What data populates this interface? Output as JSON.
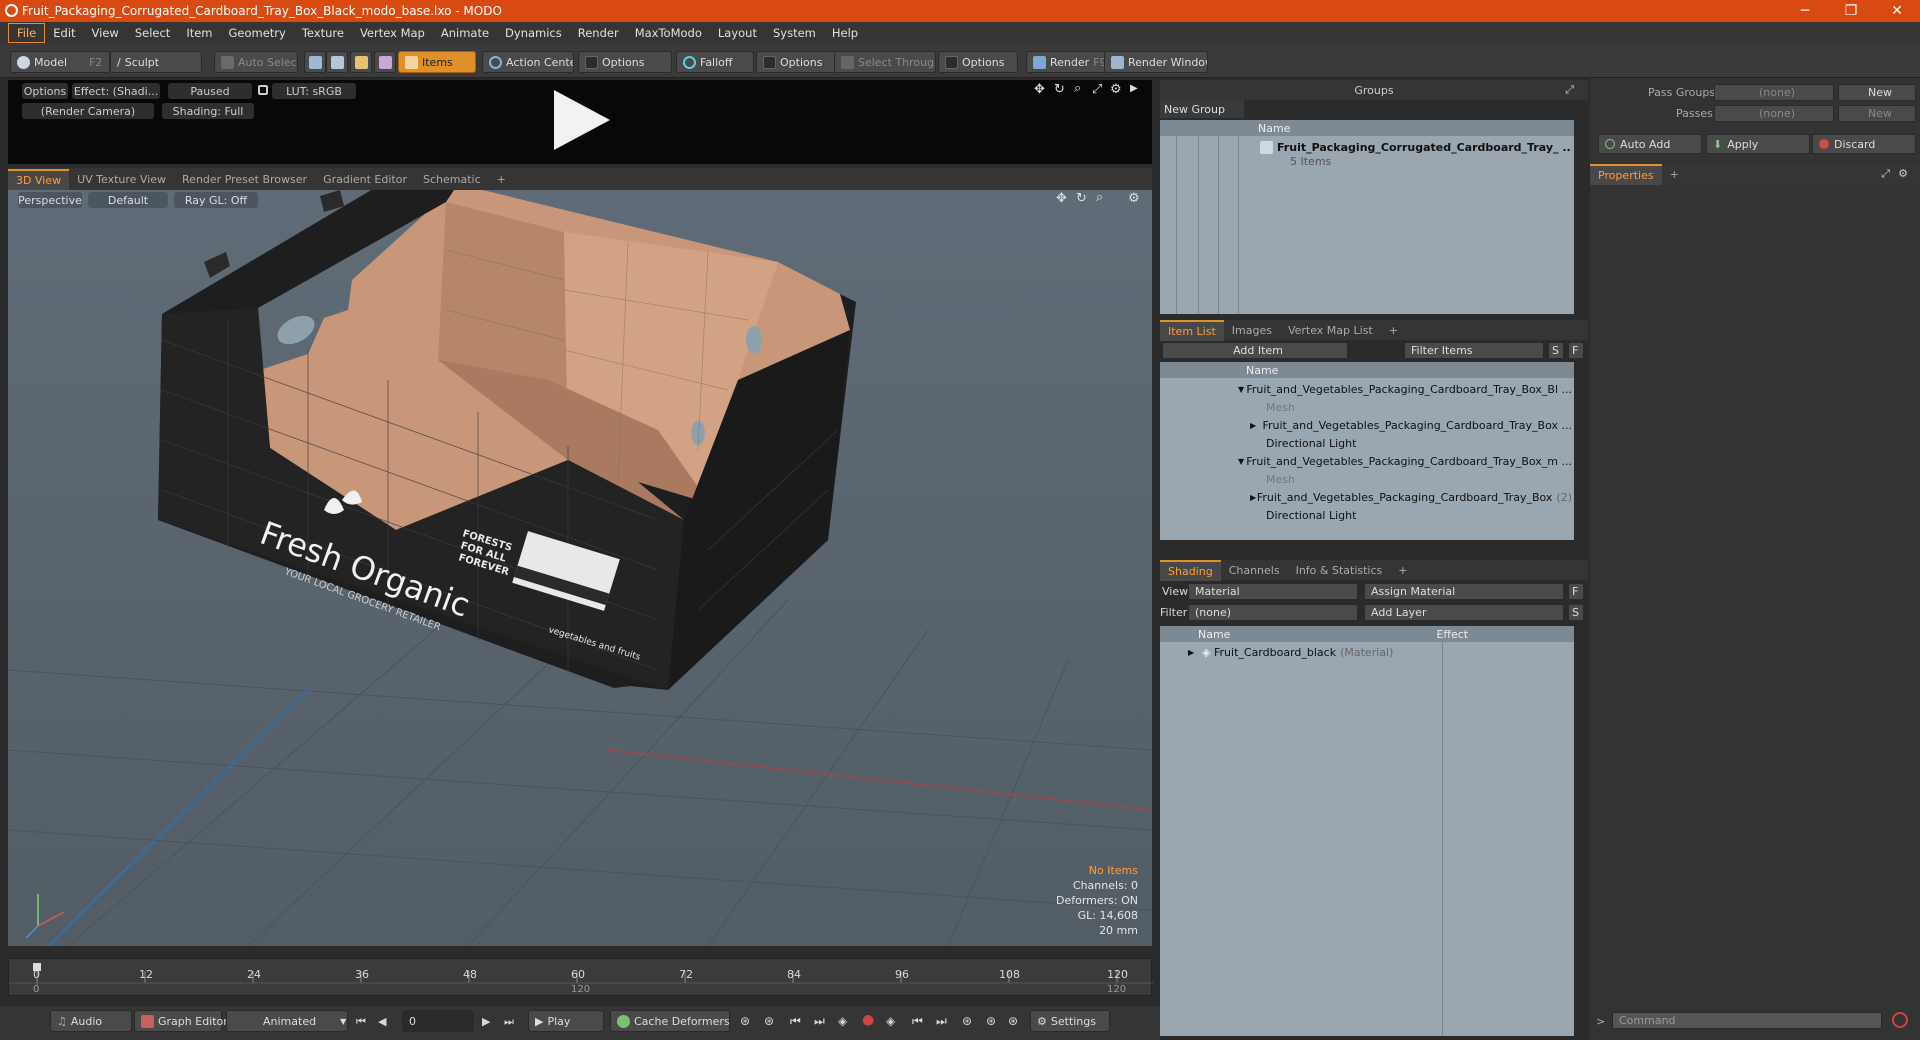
{
  "window": {
    "title": "Fruit_Packaging_Corrugated_Cardboard_Tray_Box_Black_modo_base.lxo - MODO",
    "min": "─",
    "max": "❐",
    "close": "✕"
  },
  "menu": [
    "File",
    "Edit",
    "View",
    "Select",
    "Item",
    "Geometry",
    "Texture",
    "Vertex Map",
    "Animate",
    "Dynamics",
    "Render",
    "MaxToModo",
    "Layout",
    "System",
    "Help"
  ],
  "toolbar": {
    "model": "Model",
    "model_key": "F2",
    "sculpt": "Sculpt",
    "auto_select": "Auto Select",
    "items": "Items",
    "action_center": "Action Center",
    "options1": "Options",
    "falloff": "Falloff",
    "options2": "Options",
    "select_through": "Select Through",
    "options3": "Options",
    "render": "Render",
    "render_key": "F9",
    "render_window": "Render Window"
  },
  "preview": {
    "options": "Options",
    "effect": "Effect: (Shadi...",
    "paused": "Paused",
    "lut": "LUT: sRGB",
    "camera": "(Render Camera)",
    "shading": "Shading: Full"
  },
  "viewport_tabs": [
    "3D View",
    "UV Texture View",
    "Render Preset Browser",
    "Gradient Editor",
    "Schematic",
    "+"
  ],
  "viewport": {
    "perspective": "Perspective",
    "default": "Default",
    "raygl": "Ray GL: Off",
    "info": {
      "items": "No Items",
      "channels": "Channels: 0",
      "deformers": "Deformers: ON",
      "gl": "GL: 14,608",
      "scale": "20 mm"
    },
    "box_text": {
      "brand": "Fresh Organic",
      "tagline": "YOUR LOCAL GROCERY RETAILER",
      "forests": "FORESTS",
      "forall": "FOR ALL",
      "forever": "FOREVER",
      "label": "vegetables and fruits"
    }
  },
  "timeline": {
    "ticks": [
      "0",
      "12",
      "24",
      "36",
      "48",
      "60",
      "72",
      "84",
      "96",
      "108",
      "120"
    ],
    "lower": [
      "0",
      "120",
      "120"
    ]
  },
  "bottom": {
    "audio": "Audio",
    "graph_editor": "Graph Editor",
    "animated": "Animated",
    "frame": "0",
    "play": "Play",
    "cache": "Cache Deformers",
    "settings": "Settings"
  },
  "groups": {
    "title": "Groups",
    "new_group": "New Group",
    "col_name": "Name",
    "item_name": "Fruit_Packaging_Corrugated_Cardboard_Tray_ ...",
    "item_count": "5 Items"
  },
  "itemlist": {
    "tabs": [
      "Item List",
      "Images",
      "Vertex Map List",
      "+"
    ],
    "add_item": "Add Item",
    "filter": "Filter Items",
    "s": "S",
    "f": "F",
    "col_name": "Name",
    "rows": [
      {
        "name": "Fruit_and_Vegetables_Packaging_Cardboard_Tray_Box_Bl ..."
      },
      {
        "name": "Mesh"
      },
      {
        "name": "Fruit_and_Vegetables_Packaging_Cardboard_Tray_Box ..."
      },
      {
        "name": "Directional Light"
      },
      {
        "name": "Fruit_and_Vegetables_Packaging_Cardboard_Tray_Box_m ..."
      },
      {
        "name": "Mesh"
      },
      {
        "name": "Fruit_and_Vegetables_Packaging_Cardboard_Tray_Box"
      },
      {
        "name": "Directional Light"
      }
    ],
    "row6_suffix": "(2)"
  },
  "shading": {
    "tabs": [
      "Shading",
      "Channels",
      "Info & Statistics",
      "+"
    ],
    "view_label": "View",
    "view_value": "Material",
    "assign": "Assign Material",
    "f": "F",
    "filter_label": "Filter",
    "filter_value": "(none)",
    "add_layer": "Add Layer",
    "s": "S",
    "col_name": "Name",
    "col_effect": "Effect",
    "row_name": "Fruit_Cardboard_black",
    "row_type": "(Material)"
  },
  "right": {
    "pass_groups": "Pass Groups",
    "passes": "Passes",
    "none1": "(none)",
    "none2": "(none)",
    "new1": "New",
    "new2": "New",
    "auto_add": "Auto Add",
    "apply": "Apply",
    "discard": "Discard",
    "properties": "Properties",
    "plus": "+",
    "command": "Command"
  },
  "colors": {
    "accent": "#e0902a",
    "titlebar": "#d84a12"
  }
}
